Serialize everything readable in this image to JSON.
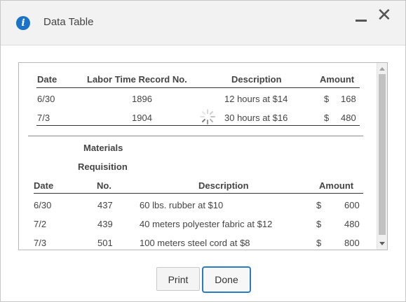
{
  "window": {
    "title": "Data Table"
  },
  "labor": {
    "headers": {
      "date": "Date",
      "record": "Labor Time Record No.",
      "description": "Description",
      "amount": "Amount"
    },
    "rows": [
      {
        "date": "6/30",
        "record": "1896",
        "description": "12 hours at $14",
        "currency": "$",
        "amount": "168"
      },
      {
        "date": "7/3",
        "record": "1904",
        "description": "30 hours at $16",
        "currency": "$",
        "amount": "480"
      }
    ]
  },
  "materials": {
    "heading_line1": "Materials",
    "heading_line2": "Requisition",
    "headers": {
      "date": "Date",
      "no": "No.",
      "description": "Description",
      "amount": "Amount"
    },
    "rows": [
      {
        "date": "6/30",
        "no": "437",
        "description": "60 lbs. rubber at $10",
        "currency": "$",
        "amount": "600"
      },
      {
        "date": "7/2",
        "no": "439",
        "description": "40 meters polyester fabric at $12",
        "currency": "$",
        "amount": "480"
      },
      {
        "date": "7/3",
        "no": "501",
        "description": "100 meters steel cord at $8",
        "currency": "$",
        "amount": "800"
      }
    ]
  },
  "buttons": {
    "print": "Print",
    "done": "Done"
  },
  "colors": {
    "accent": "#2a7bbf",
    "info_icon": "#1a72c9"
  }
}
